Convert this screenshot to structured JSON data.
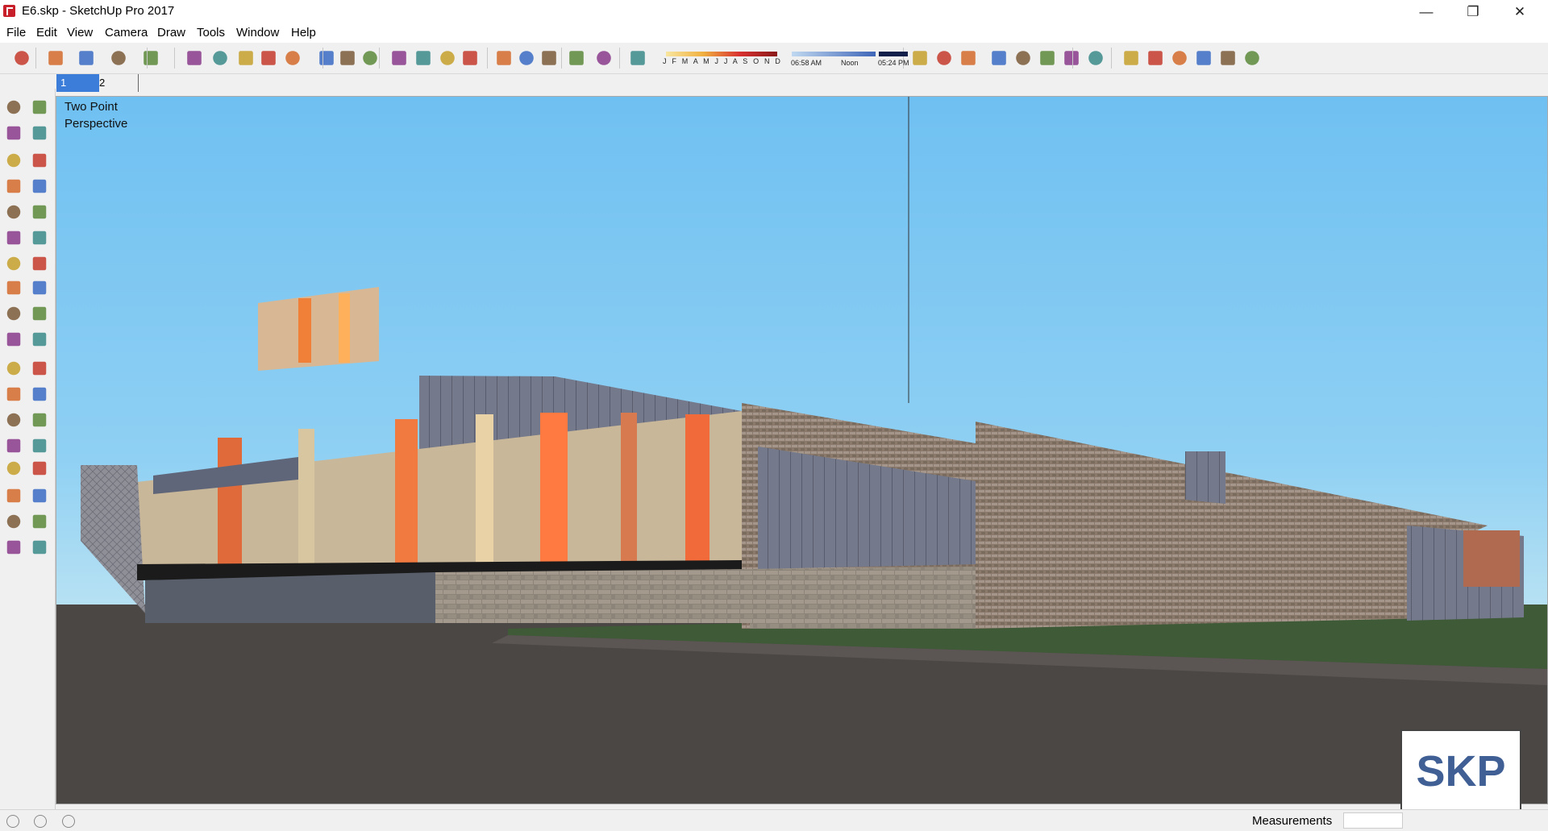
{
  "window": {
    "title": "E6.skp - SketchUp Pro 2017",
    "controls": [
      "—",
      "❐",
      "✕"
    ]
  },
  "menu": [
    "File",
    "Edit",
    "View",
    "Camera",
    "Draw",
    "Tools",
    "Window",
    "Help"
  ],
  "shadow_settings": {
    "months": "J F M A M J J A S O N D",
    "time_start": "06:58 AM",
    "time_mid": "Noon",
    "time_end": "05:24 PM"
  },
  "scene_tabs": [
    "1",
    "2"
  ],
  "active_scene": "1",
  "viewport": {
    "camera_mode_line1": "Two Point",
    "camera_mode_line2": "Perspective",
    "sky_color": "#79c6f2",
    "ground_color": "#4b4744",
    "grass_color": "#3e5a36"
  },
  "logo_text": "SKP",
  "status": {
    "measurements_label": "Measurements",
    "measurements_value": ""
  },
  "toolbar_icons": [
    "select-icon",
    "eraser-icon",
    "pencil-icon",
    "arc-icon",
    "rectangle-icon",
    "push-pull-icon",
    "follow-me-icon",
    "move-icon",
    "rotate-icon",
    "scale-icon",
    "tape-measure-icon",
    "text-icon",
    "paint-bucket-icon",
    "orbit-icon",
    "pan-icon",
    "zoom-icon",
    "zoom-extents-icon",
    "warehouse-icon",
    "extension-warehouse-icon",
    "layout-icon",
    "ruby-icon",
    "shadows-icon",
    "match-photo-icon",
    "fog-icon",
    "section-icon",
    "xray-icon",
    "wireframe-icon",
    "hidden-line-icon",
    "shaded-icon",
    "textured-icon",
    "monochrome-icon",
    "iso-view-icon",
    "top-view-icon",
    "front-view-icon",
    "right-view-icon",
    "back-view-icon",
    "left-view-icon"
  ]
}
